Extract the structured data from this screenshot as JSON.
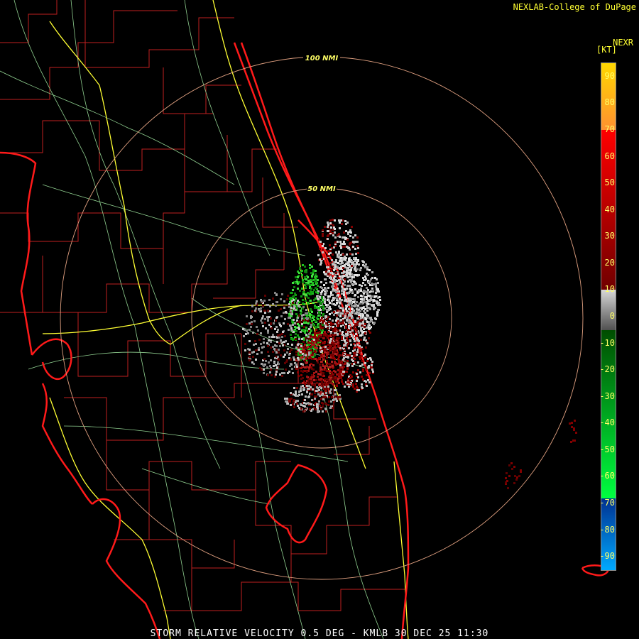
{
  "credit": "NEXLAB-College of DuPage",
  "product_code": "NEXR",
  "units": "[KT]",
  "footer": "STORM RELATIVE VELOCITY 0.5 DEG - KMLB 30 DEC 25 11:30",
  "range_rings": [
    {
      "label": "50 NMI",
      "nmi": 50
    },
    {
      "label": "100 NMI",
      "nmi": 100
    }
  ],
  "colors": {
    "coast": "#ff1a1a",
    "county": "#c02020",
    "highway": "#ffff33",
    "road": "#90d090",
    "ring": "#e0a080",
    "label": "#ffff66"
  },
  "color_scale": {
    "ticks": [
      "90",
      "80",
      "70",
      "60",
      "50",
      "40",
      "30",
      "20",
      "10",
      "0",
      "-10",
      "-20",
      "-30",
      "-40",
      "-50",
      "-60",
      "-70",
      "-80",
      "-90"
    ],
    "segments": [
      {
        "from": 95,
        "to": 70,
        "color": "#ffd700",
        "color2": "#ff9030"
      },
      {
        "from": 70,
        "to": 10,
        "color": "#ff0000",
        "color2": "#700000"
      },
      {
        "from": 10,
        "to": -5,
        "color": "#d8d8d8",
        "color2": "#505050"
      },
      {
        "from": -5,
        "to": -68,
        "color": "#004d00",
        "color2": "#00ff40"
      },
      {
        "from": -68,
        "to": -95,
        "color": "#003090",
        "color2": "#00aaff"
      }
    ]
  }
}
